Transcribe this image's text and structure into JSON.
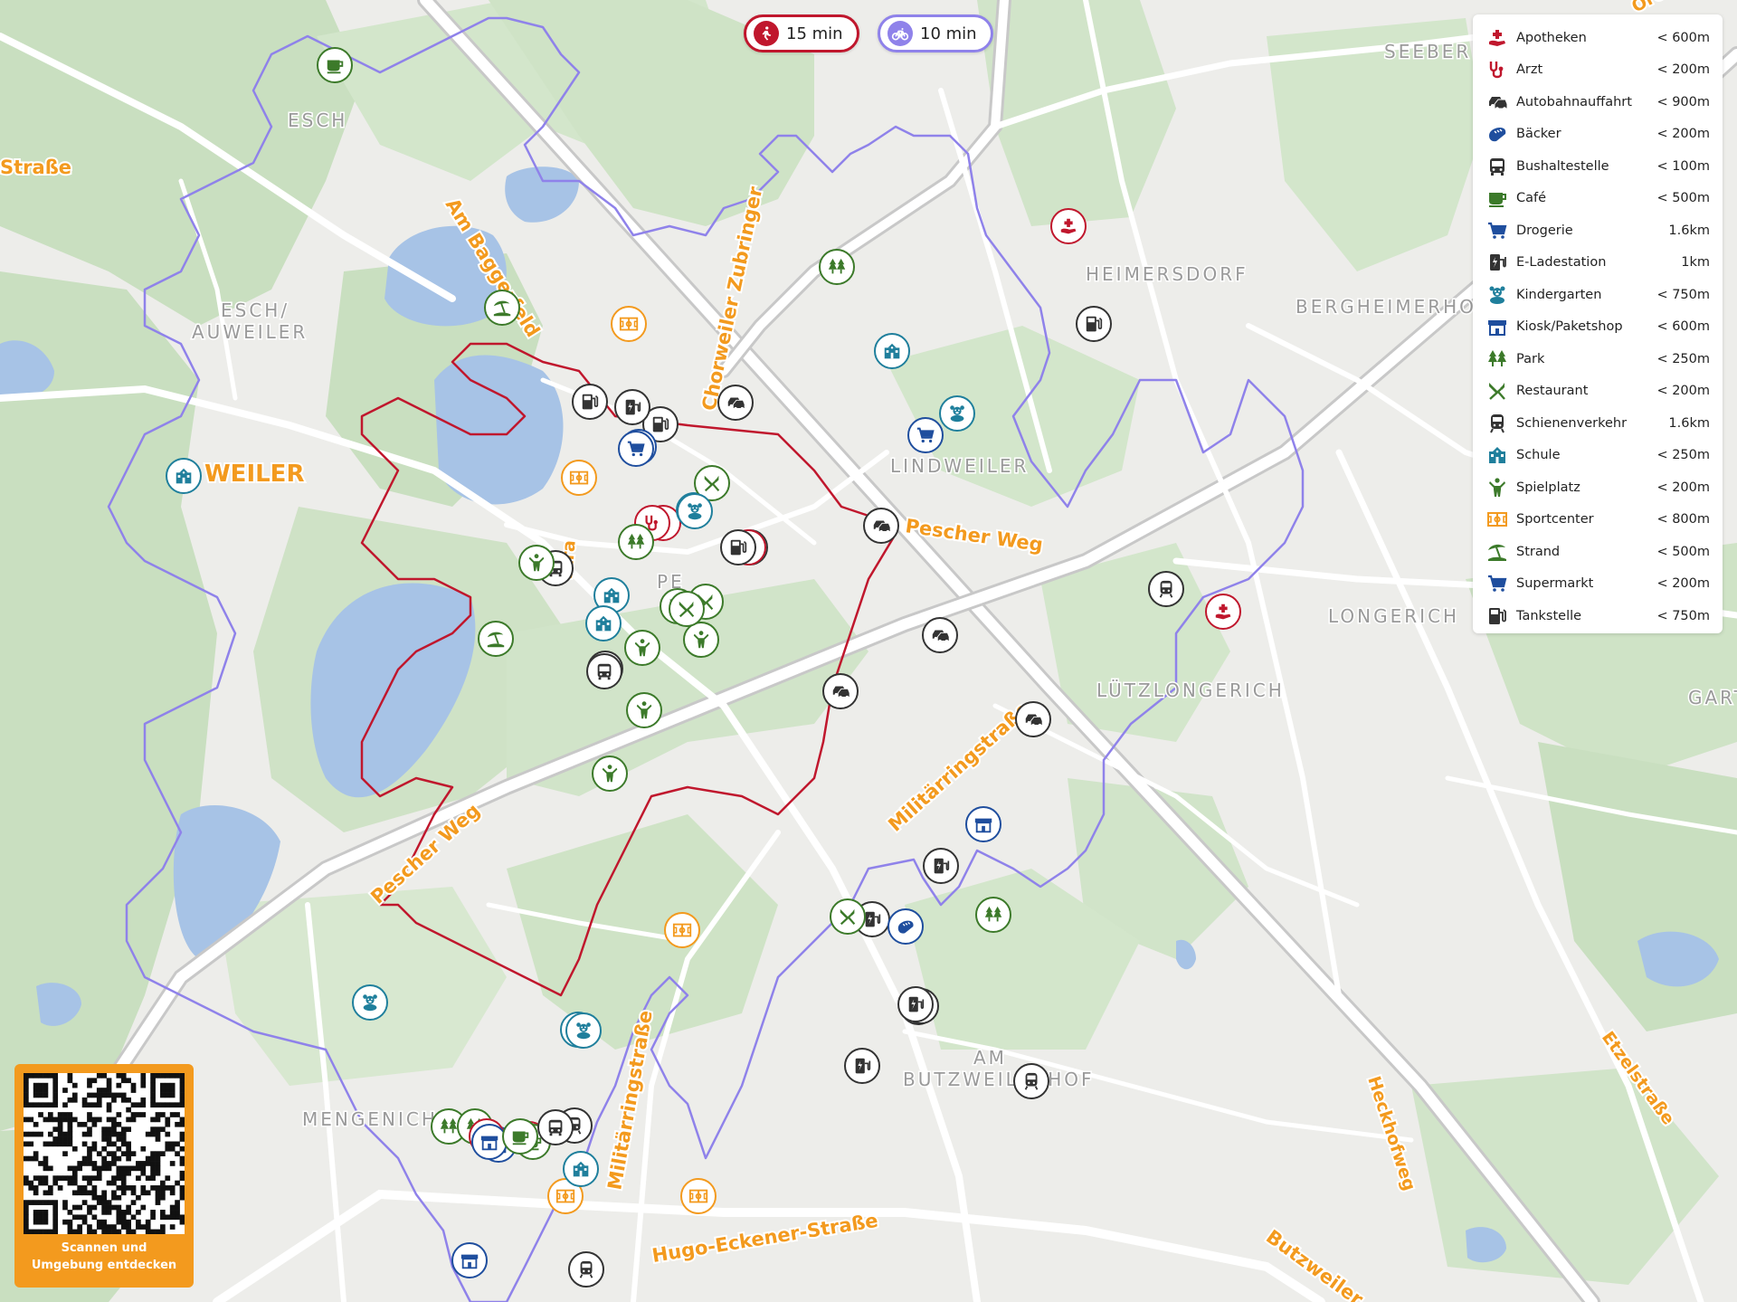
{
  "colors": {
    "walk": "#c0172d",
    "bike": "#8f82ea",
    "accent": "#f39a1e",
    "green_dark": "#3c7a2a",
    "blue_dark": "#1f4e9e",
    "teal": "#1f7f9c",
    "grey_dark": "#333333",
    "map_green": "#c9dfc0",
    "map_water": "#a7c3e6"
  },
  "isochrones": [
    {
      "mode": "walk",
      "icon": "walking-icon",
      "label": "15 min"
    },
    {
      "mode": "bike",
      "icon": "bicycle-icon",
      "label": "10 min"
    }
  ],
  "legend": [
    {
      "icon": "pharmacy-icon",
      "name": "Apotheken",
      "distance": "< 600m",
      "color": "#c0172d"
    },
    {
      "icon": "stethoscope-icon",
      "name": "Arzt",
      "distance": "< 200m",
      "color": "#c0172d"
    },
    {
      "icon": "car-icon",
      "name": "Autobahnauffahrt",
      "distance": "< 900m",
      "color": "#333333"
    },
    {
      "icon": "bread-icon",
      "name": "Bäcker",
      "distance": "< 200m",
      "color": "#1f4e9e"
    },
    {
      "icon": "bus-icon",
      "name": "Bushaltestelle",
      "distance": "< 100m",
      "color": "#333333"
    },
    {
      "icon": "coffee-icon",
      "name": "Café",
      "distance": "< 500m",
      "color": "#3c7a2a"
    },
    {
      "icon": "cart-icon",
      "name": "Drogerie",
      "distance": "1.6km",
      "color": "#1f4e9e"
    },
    {
      "icon": "charging-icon",
      "name": "E-Ladestation",
      "distance": "1km",
      "color": "#333333"
    },
    {
      "icon": "teddy-icon",
      "name": "Kindergarten",
      "distance": "< 750m",
      "color": "#1f7f9c"
    },
    {
      "icon": "shop-icon",
      "name": "Kiosk/Paketshop",
      "distance": "< 600m",
      "color": "#1f4e9e"
    },
    {
      "icon": "tree-icon",
      "name": "Park",
      "distance": "< 250m",
      "color": "#3c7a2a"
    },
    {
      "icon": "cutlery-icon",
      "name": "Restaurant",
      "distance": "< 200m",
      "color": "#3c7a2a"
    },
    {
      "icon": "train-icon",
      "name": "Schienenverkehr",
      "distance": "1.6km",
      "color": "#333333"
    },
    {
      "icon": "school-icon",
      "name": "Schule",
      "distance": "< 250m",
      "color": "#1f7f9c"
    },
    {
      "icon": "playground-icon",
      "name": "Spielplatz",
      "distance": "< 200m",
      "color": "#3c7a2a"
    },
    {
      "icon": "sportscenter-icon",
      "name": "Sportcenter",
      "distance": "< 800m",
      "color": "#f39a1e"
    },
    {
      "icon": "beach-icon",
      "name": "Strand",
      "distance": "< 500m",
      "color": "#3c7a2a"
    },
    {
      "icon": "cart-icon",
      "name": "Supermarkt",
      "distance": "< 200m",
      "color": "#1f4e9e"
    },
    {
      "icon": "fuel-icon",
      "name": "Tankstelle",
      "distance": "< 750m",
      "color": "#333333"
    }
  ],
  "streets": [
    "Am Baggerfeld",
    "Chorweiler Zubringer",
    "Pescher Weg",
    "Militärringstraße",
    "Hugo-Eckener-Straße",
    "Butzweiler",
    "Heckhofweg",
    "Etzelstraße",
    "Straße",
    "stra",
    "Ore"
  ],
  "districts": [
    "ESCH",
    "ESCH/",
    "AUWEILER",
    "HEIMERSDORF",
    "BERGHEIMERHOF",
    "LINDWEILER",
    "LONGERICH",
    "LÜTZLONGERICH",
    "SEEBER",
    "GART",
    "AM",
    "BUTZWEILERHOF",
    "MENGENICH",
    "PE"
  ],
  "town_label": "WEILER",
  "qr": {
    "caption_line1": "Scannen und",
    "caption_line2": "Umgebung entdecken"
  },
  "markers": [
    {
      "type": "cafe",
      "icon": "coffee-icon"
    },
    {
      "type": "beach",
      "icon": "beach-icon"
    },
    {
      "type": "beach",
      "icon": "beach-icon"
    },
    {
      "type": "sportscenter",
      "icon": "sportscenter-icon"
    },
    {
      "type": "sportscenter",
      "icon": "sportscenter-icon"
    },
    {
      "type": "sportscenter",
      "icon": "sportscenter-icon"
    },
    {
      "type": "sportscenter",
      "icon": "sportscenter-icon"
    },
    {
      "type": "sportscenter",
      "icon": "sportscenter-icon"
    },
    {
      "type": "school",
      "icon": "school-icon"
    },
    {
      "type": "school",
      "icon": "school-icon"
    },
    {
      "type": "school",
      "icon": "school-icon"
    },
    {
      "type": "school",
      "icon": "school-icon"
    },
    {
      "type": "school",
      "icon": "school-icon"
    },
    {
      "type": "park",
      "icon": "tree-icon"
    },
    {
      "type": "park",
      "icon": "tree-icon"
    },
    {
      "type": "park",
      "icon": "tree-icon"
    },
    {
      "type": "park",
      "icon": "tree-icon"
    },
    {
      "type": "pharmacy",
      "icon": "pharmacy-icon"
    },
    {
      "type": "pharmacy",
      "icon": "pharmacy-icon"
    },
    {
      "type": "doctor",
      "icon": "stethoscope-icon"
    },
    {
      "type": "doctor",
      "icon": "stethoscope-icon"
    },
    {
      "type": "fuel",
      "icon": "fuel-icon"
    },
    {
      "type": "fuel",
      "icon": "fuel-icon"
    },
    {
      "type": "fuel",
      "icon": "fuel-icon"
    },
    {
      "type": "fuel",
      "icon": "fuel-icon"
    },
    {
      "type": "motorway",
      "icon": "car-icon"
    },
    {
      "type": "motorway",
      "icon": "car-icon"
    },
    {
      "type": "motorway",
      "icon": "car-icon"
    },
    {
      "type": "motorway",
      "icon": "car-icon"
    },
    {
      "type": "motorway",
      "icon": "car-icon"
    },
    {
      "type": "kindergarten",
      "icon": "teddy-icon"
    },
    {
      "type": "kindergarten",
      "icon": "teddy-icon"
    },
    {
      "type": "kindergarten",
      "icon": "teddy-icon"
    },
    {
      "type": "kindergarten",
      "icon": "teddy-icon"
    },
    {
      "type": "drugstore",
      "icon": "cart-icon"
    },
    {
      "type": "supermarket",
      "icon": "cart-icon"
    },
    {
      "type": "charging",
      "icon": "charging-icon"
    },
    {
      "type": "charging",
      "icon": "charging-icon"
    },
    {
      "type": "charging",
      "icon": "charging-icon"
    },
    {
      "type": "charging",
      "icon": "charging-icon"
    },
    {
      "type": "charging",
      "icon": "charging-icon"
    },
    {
      "type": "restaurant",
      "icon": "cutlery-icon"
    },
    {
      "type": "restaurant",
      "icon": "cutlery-icon"
    },
    {
      "type": "restaurant",
      "icon": "cutlery-icon"
    },
    {
      "type": "bus",
      "icon": "bus-icon"
    },
    {
      "type": "bus",
      "icon": "bus-icon"
    },
    {
      "type": "train",
      "icon": "train-icon"
    },
    {
      "type": "train",
      "icon": "train-icon"
    },
    {
      "type": "train",
      "icon": "train-icon"
    },
    {
      "type": "train",
      "icon": "train-icon"
    },
    {
      "type": "playground",
      "icon": "playground-icon"
    },
    {
      "type": "playground",
      "icon": "playground-icon"
    },
    {
      "type": "playground",
      "icon": "playground-icon"
    },
    {
      "type": "playground",
      "icon": "playground-icon"
    },
    {
      "type": "kiosk",
      "icon": "shop-icon"
    },
    {
      "type": "kiosk",
      "icon": "shop-icon"
    },
    {
      "type": "kiosk",
      "icon": "shop-icon"
    },
    {
      "type": "bakery",
      "icon": "bread-icon"
    },
    {
      "type": "cafe",
      "icon": "coffee-icon"
    },
    {
      "type": "pharmacy",
      "icon": "pharmacy-icon"
    },
    {
      "type": "doctor",
      "icon": "stethoscope-icon"
    },
    {
      "type": "fuel",
      "icon": "fuel-icon"
    },
    {
      "type": "supermarket",
      "icon": "cart-icon"
    },
    {
      "type": "kindergarten",
      "icon": "teddy-icon"
    },
    {
      "type": "restaurant",
      "icon": "cutlery-icon"
    },
    {
      "type": "bus",
      "icon": "bus-icon"
    },
    {
      "type": "park",
      "icon": "tree-icon"
    },
    {
      "type": "school",
      "icon": "school-icon"
    },
    {
      "type": "kiosk",
      "icon": "shop-icon"
    },
    {
      "type": "doctor",
      "icon": "stethoscope-icon"
    },
    {
      "type": "playground",
      "icon": "playground-icon"
    },
    {
      "type": "cafe",
      "icon": "coffee-icon"
    },
    {
      "type": "bus",
      "icon": "bus-icon"
    },
    {
      "type": "restaurant",
      "icon": "cutlery-icon"
    },
    {
      "type": "fuel",
      "icon": "fuel-icon"
    },
    {
      "type": "charging",
      "icon": "charging-icon"
    }
  ]
}
